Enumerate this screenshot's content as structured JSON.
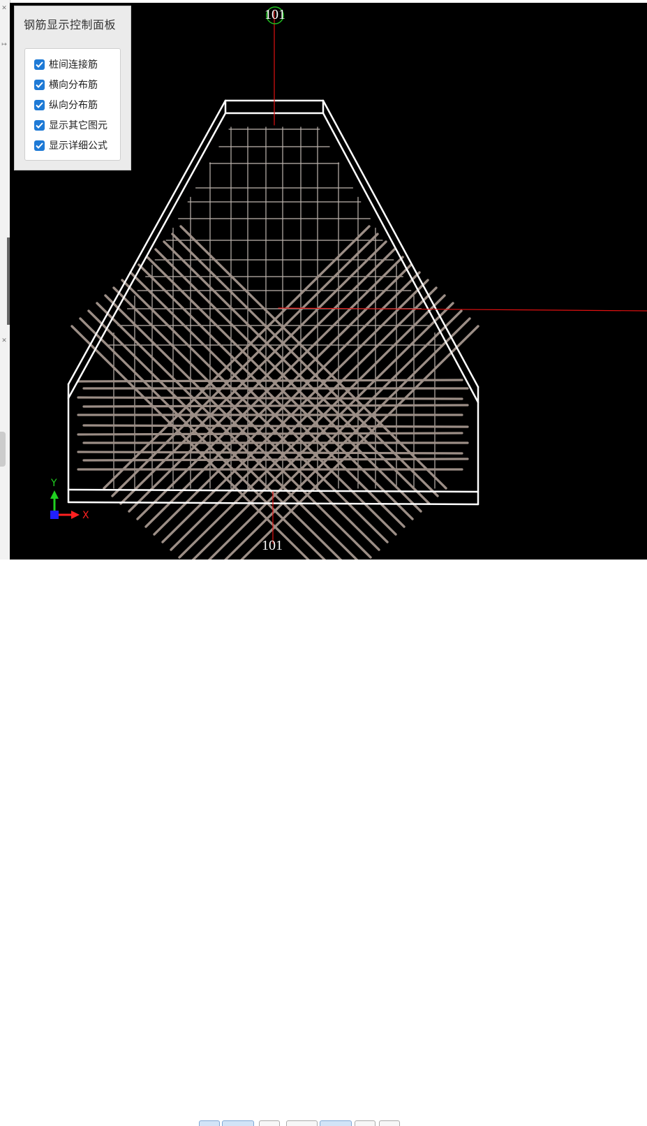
{
  "panel": {
    "title": "钢筋显示控制面板",
    "options": [
      {
        "label": "桩间连接筋",
        "checked": true
      },
      {
        "label": "横向分布筋",
        "checked": true
      },
      {
        "label": "纵向分布筋",
        "checked": true
      },
      {
        "label": "显示其它图元",
        "checked": true
      },
      {
        "label": "显示详细公式",
        "checked": true
      }
    ]
  },
  "viewport": {
    "axis_label_top": "101",
    "axis_label_bottom": "101",
    "axis_y_label": "Y",
    "axis_x_label": "X"
  },
  "colors": {
    "background": "#000000",
    "outline": "#ffffff",
    "axis_line": "#e01010",
    "rebar_thick": "#9c8e86",
    "rebar_thin": "#bfb6b0",
    "gizmo_x": "#ff2020",
    "gizmo_y": "#20d020",
    "gizmo_z": "#2020ff",
    "checkbox": "#1e7ad6"
  }
}
